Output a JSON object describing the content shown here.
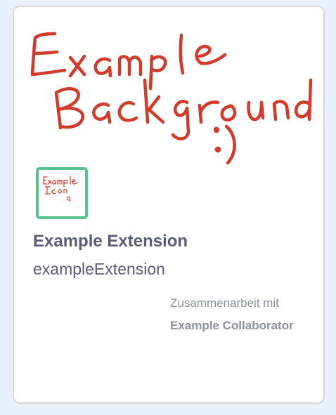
{
  "extension_card": {
    "background_image": {
      "handwritten_text": "Example Background :)",
      "ink_color": "#d23a2a"
    },
    "icon_image": {
      "handwritten_text": "Example Icon :)",
      "border_color": "#59c08f"
    },
    "title": "Example Extension",
    "extension_id": "exampleExtension",
    "collaborator_label": "Zusammenarbeit mit",
    "collaborator_name": "Example Collaborator"
  }
}
